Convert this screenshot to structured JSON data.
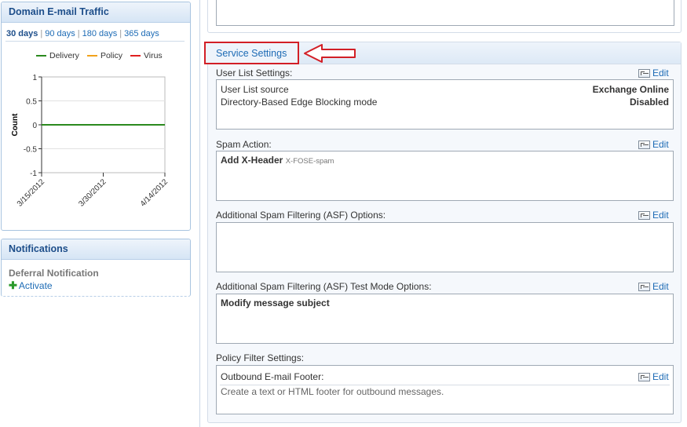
{
  "traffic": {
    "title": "Domain E-mail Traffic",
    "ranges": [
      "30 days",
      "90 days",
      "180 days",
      "365 days"
    ],
    "active_range": "30 days",
    "legend": [
      {
        "name": "Delivery",
        "color": "#2b8a1e"
      },
      {
        "name": "Policy",
        "color": "#f2a21b"
      },
      {
        "name": "Virus",
        "color": "#e02020"
      }
    ]
  },
  "chart_data": {
    "type": "line",
    "ylabel": "Count",
    "ylim": [
      -1,
      1
    ],
    "yticks": [
      "1",
      "0.5",
      "0",
      "-0.5",
      "-1"
    ],
    "x": [
      "3/15/2012",
      "3/30/2012",
      "4/14/2012"
    ],
    "series": [
      {
        "name": "Delivery",
        "values": [
          0,
          0,
          0
        ],
        "color": "#2b8a1e"
      },
      {
        "name": "Policy",
        "values": [
          0,
          0,
          0
        ],
        "color": "#f2a21b"
      },
      {
        "name": "Virus",
        "values": [
          0,
          0,
          0
        ],
        "color": "#e02020"
      }
    ],
    "grid": true,
    "legend_position": "top"
  },
  "notifications": {
    "title": "Notifications",
    "item_title": "Deferral Notification",
    "activate_label": "Activate"
  },
  "service": {
    "title": "Service Settings",
    "edit_label": "Edit",
    "user_list": {
      "label": "User List Settings:",
      "rows": [
        {
          "name": "User List source",
          "value": "Exchange Online"
        },
        {
          "name": "Directory-Based Edge Blocking mode",
          "value": "Disabled"
        }
      ]
    },
    "spam_action": {
      "label": "Spam Action:",
      "value": "Add X-Header",
      "note": "X-FOSE-spam"
    },
    "asf": {
      "label": "Additional Spam Filtering (ASF) Options:"
    },
    "asf_test": {
      "label": "Additional Spam Filtering (ASF) Test Mode Options:",
      "value": "Modify message subject"
    },
    "policy": {
      "label": "Policy Filter Settings:",
      "footer_label": "Outbound E-mail Footer:",
      "footer_hint": "Create a text or HTML footer for outbound messages."
    }
  },
  "colors": {
    "accent": "#1d6bb5",
    "highlight_box": "#d21f26"
  }
}
